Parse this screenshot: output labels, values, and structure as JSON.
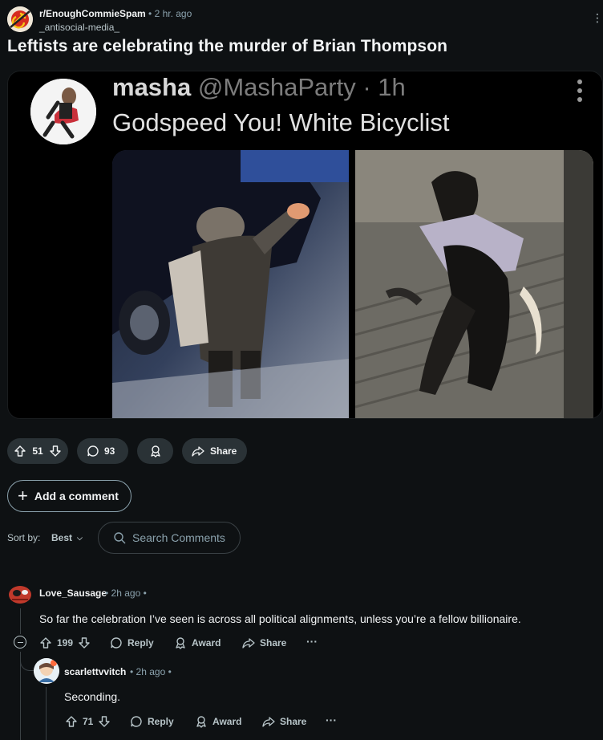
{
  "post": {
    "subreddit": "r/EnoughCommieSpam",
    "time": "2 hr. ago",
    "author": "_antisocial-media_",
    "title": "Leftists are celebrating the murder of Brian Thompson"
  },
  "tweet": {
    "name": "masha",
    "handle_time": "@MashaParty · 1h",
    "text": "Godspeed You! White Bicyclist"
  },
  "actions": {
    "upvotes": "51",
    "comments": "93",
    "share": "Share"
  },
  "add_comment": "Add a comment",
  "sort": {
    "label": "Sort by:",
    "value": "Best"
  },
  "search": {
    "placeholder": "Search Comments"
  },
  "comments": [
    {
      "author": "Love_Sausage",
      "meta": "• 2h ago •",
      "body": "So far the celebration I’ve seen is across all political alignments, unless you’re a fellow billionaire.",
      "votes": "199",
      "reply": "Reply",
      "award": "Award",
      "share": "Share",
      "more": "···"
    },
    {
      "author": "scarlettvvitch",
      "meta": "• 2h ago •",
      "body": "Seconding.",
      "votes": "71",
      "reply": "Reply",
      "award": "Award",
      "share": "Share",
      "more": "···"
    }
  ]
}
